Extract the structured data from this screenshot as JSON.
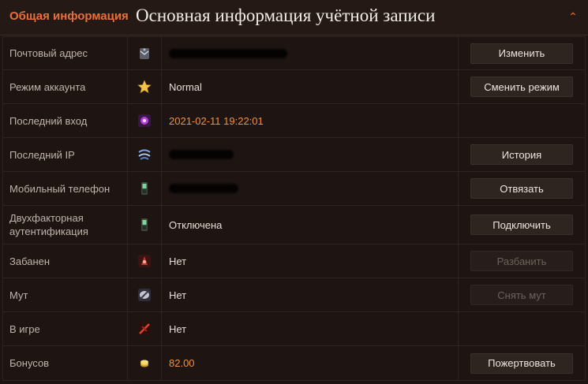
{
  "header": {
    "tab_title": "Общая информация",
    "main_title": "Основная информация учётной записи",
    "collapse_glyph": "⌃"
  },
  "colors": {
    "accent": "#e8703a",
    "value_highlight": "#f0913e",
    "background": "#1e1512"
  },
  "rows": [
    {
      "label": "Почтовый адрес",
      "icon": "mail-icon",
      "value": "",
      "masked": true,
      "action": "Изменить",
      "action_enabled": true
    },
    {
      "label": "Режим аккаунта",
      "icon": "star-icon",
      "value": "Normal",
      "action": "Сменить режим",
      "action_enabled": true
    },
    {
      "label": "Последний вход",
      "icon": "login-icon",
      "value": "2021-02-11 19:22:01",
      "action": "",
      "action_enabled": false
    },
    {
      "label": "Последний IP",
      "icon": "network-icon",
      "value": "",
      "masked": true,
      "action": "История",
      "action_enabled": true
    },
    {
      "label": "Мобильный телефон",
      "icon": "phone-icon",
      "value": "",
      "masked": true,
      "action": "Отвязать",
      "action_enabled": true
    },
    {
      "label": "Двухфакторная аутентификация",
      "icon": "two-factor-phone-icon",
      "value": "Отключена",
      "action": "Подключить",
      "action_enabled": true
    },
    {
      "label": "Забанен",
      "icon": "ban-icon",
      "value": "Нет",
      "action": "Разбанить",
      "action_enabled": false
    },
    {
      "label": "Мут",
      "icon": "mute-icon",
      "value": "Нет",
      "action": "Снять мут",
      "action_enabled": false
    },
    {
      "label": "В игре",
      "icon": "in-game-icon",
      "value": "Нет",
      "action": "",
      "action_enabled": false
    },
    {
      "label": "Бонусов",
      "icon": "coins-icon",
      "value": "82.00",
      "action": "Пожертвовать",
      "action_enabled": true
    }
  ]
}
